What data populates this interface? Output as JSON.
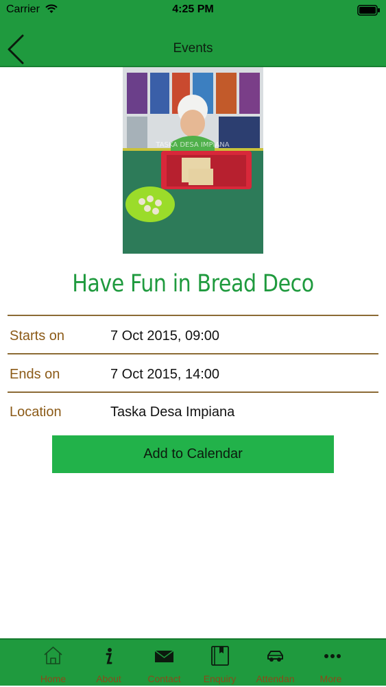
{
  "status_bar": {
    "carrier": "Carrier",
    "time": "4:25 PM"
  },
  "header": {
    "title": "Events"
  },
  "event": {
    "photo": "child-decorating-bread-photo",
    "photo_watermark": "TASKA DESA IMPIANA",
    "title": "Have Fun in Bread Deco",
    "rows": [
      {
        "label": "Starts on",
        "value": "7 Oct 2015, 09:00"
      },
      {
        "label": "Ends on",
        "value": "7 Oct 2015, 14:00"
      },
      {
        "label": "Location",
        "value": "Taska Desa Impiana"
      }
    ],
    "add_button": "Add to Calendar"
  },
  "tabs": [
    {
      "label": "Home",
      "icon": "home-icon"
    },
    {
      "label": "About",
      "icon": "info-icon"
    },
    {
      "label": "Contact",
      "icon": "envelope-icon"
    },
    {
      "label": "Enquiry",
      "icon": "book-icon"
    },
    {
      "label": "Attendan",
      "icon": "car-icon"
    },
    {
      "label": "More",
      "icon": "more-dots-icon"
    }
  ],
  "colors": {
    "brand_green": "#1f9a3e",
    "button_green": "#22b24a",
    "label_brown": "#8b5a17",
    "divider": "#8b6a34"
  }
}
